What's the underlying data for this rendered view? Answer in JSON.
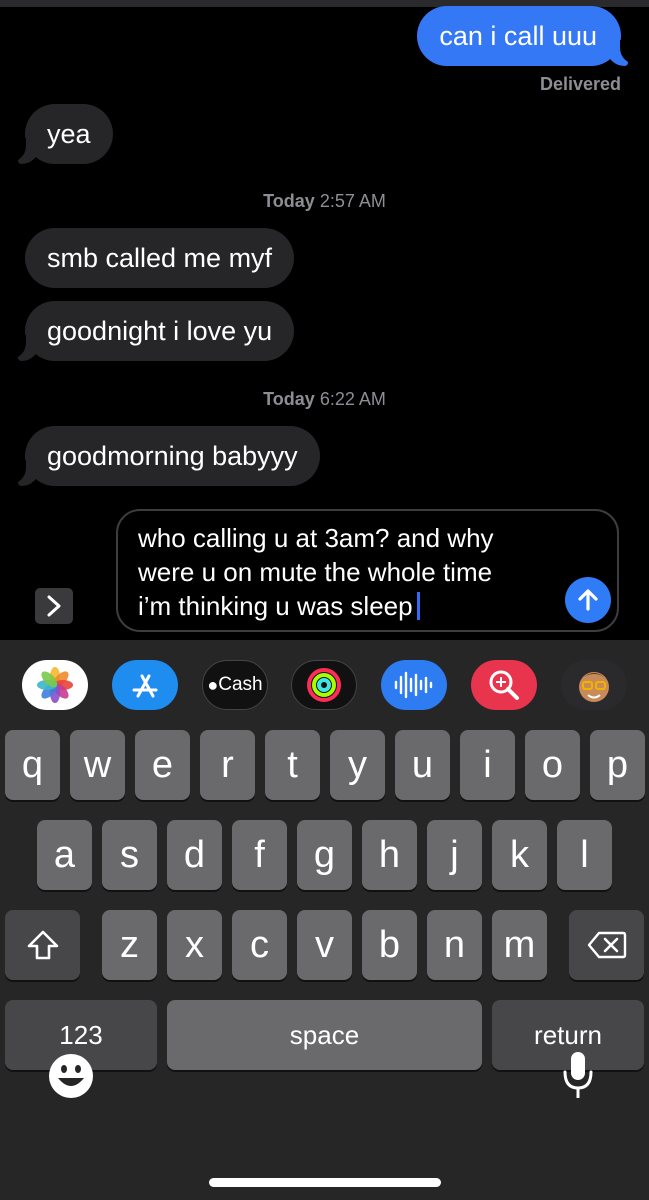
{
  "thread": {
    "outgoing": [
      {
        "text": "can i call uuu",
        "status": "Delivered"
      }
    ],
    "incoming": [
      {
        "text": "yea"
      },
      {
        "text": "smb called me myf"
      },
      {
        "text": "goodnight i love yu"
      },
      {
        "text": "goodmorning babyyy"
      }
    ],
    "timestamps": [
      {
        "day": "Today",
        "time": "2:57 AM"
      },
      {
        "day": "Today",
        "time": "6:22 AM"
      }
    ]
  },
  "compose": {
    "lines": [
      "who calling u at 3am? and why",
      "were u on mute the whole time",
      "i’m thinking u was sleep"
    ]
  },
  "app_strip": {
    "icons": [
      "photos-icon",
      "app-store-icon",
      "apple-cash-icon",
      "activity-icon",
      "audio-message-icon",
      "image-search-icon",
      "memoji-icon"
    ],
    "cash_label": "Cash"
  },
  "keyboard": {
    "row1": [
      "q",
      "w",
      "e",
      "r",
      "t",
      "y",
      "u",
      "i",
      "o",
      "p"
    ],
    "row2": [
      "a",
      "s",
      "d",
      "f",
      "g",
      "h",
      "j",
      "k",
      "l"
    ],
    "row3": [
      "z",
      "x",
      "c",
      "v",
      "b",
      "n",
      "m"
    ],
    "numbers_label": "123",
    "space_label": "space",
    "return_label": "return"
  },
  "colors": {
    "accent": "#3478f6",
    "incoming_bubble": "#262628",
    "keyboard_bg": "#262626",
    "key": "#6a6a6c",
    "key_dark": "#474749"
  }
}
